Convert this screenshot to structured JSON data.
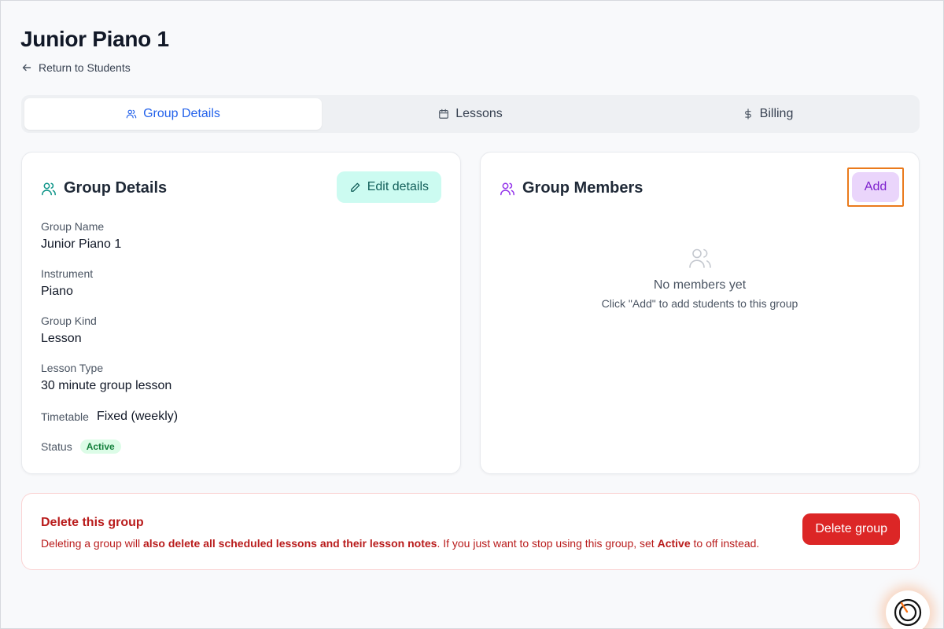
{
  "page": {
    "title": "Junior Piano 1",
    "back_label": "Return to Students"
  },
  "tabs": [
    {
      "label": "Group Details",
      "icon": "users-icon",
      "active": true
    },
    {
      "label": "Lessons",
      "icon": "calendar-icon",
      "active": false
    },
    {
      "label": "Billing",
      "icon": "dollar-icon",
      "active": false
    }
  ],
  "details_card": {
    "title": "Group Details",
    "edit_label": "Edit details",
    "fields": {
      "group_name": {
        "label": "Group Name",
        "value": "Junior Piano 1"
      },
      "instrument": {
        "label": "Instrument",
        "value": "Piano"
      },
      "group_kind": {
        "label": "Group Kind",
        "value": "Lesson"
      },
      "lesson_type": {
        "label": "Lesson Type",
        "value": "30 minute group lesson"
      },
      "timetable": {
        "label": "Timetable",
        "value": "Fixed (weekly)"
      },
      "status": {
        "label": "Status",
        "value": "Active"
      }
    }
  },
  "members_card": {
    "title": "Group Members",
    "add_label": "Add",
    "empty_title": "No members yet",
    "empty_subtitle": "Click \"Add\" to add students to this group"
  },
  "danger_zone": {
    "title": "Delete this group",
    "text_1": "Deleting a group will ",
    "text_2": "also delete all scheduled lessons and their lesson notes",
    "text_3": ". If you just want to stop using this group, set ",
    "text_4": "Active",
    "text_5": " to off instead.",
    "button_label": "Delete group"
  },
  "colors": {
    "accent_blue": "#2563eb",
    "teal": "#0d9488",
    "purple": "#9333ea",
    "danger": "#dc2626",
    "highlight": "#ea7a1c"
  }
}
